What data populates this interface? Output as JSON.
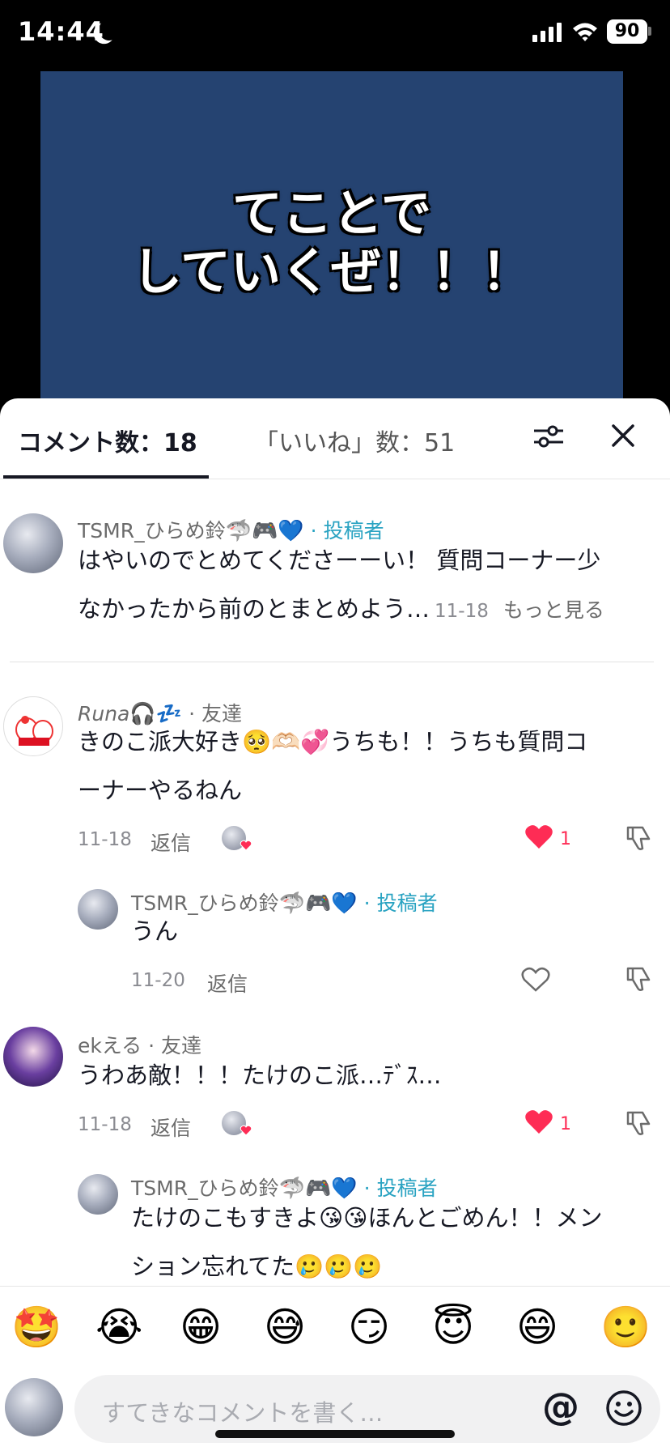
{
  "status_bar": {
    "time": "14:44",
    "battery": "90"
  },
  "video": {
    "caption_line1": "てことで",
    "caption_line2": "していくぜ！！！"
  },
  "tabs": {
    "comments": "コメント数：18",
    "likes": "「いいね」数：51"
  },
  "comments": [
    {
      "username": "TSMR_ひらめ鈴",
      "username_emoji": "🦈🎮💙",
      "tag": "· 投稿者",
      "text_line1": "はやいのでとめてくださーーい！ 質問コーナー少",
      "text_line2": "なかったから前のとまとめよう…",
      "date": "11-18",
      "more": "もっと見る"
    },
    {
      "username": "Runa",
      "username_emoji": "🎧💤",
      "tag": "· 友達",
      "text_line1": "きのこ派大好き🥺🫶🏻💞うちも！！うちも質問コ",
      "text_line2": "ーナーやるねん",
      "date": "11-18",
      "reply": "返信",
      "likes": "1"
    },
    {
      "username": "TSMR_ひらめ鈴",
      "username_emoji": "🦈🎮💙",
      "tag": "· 投稿者",
      "text_line1": "うん",
      "date": "11-20",
      "reply": "返信"
    },
    {
      "username": "ekえる",
      "tag": "· 友達",
      "text_line1": "うわあ敵！！！たけのこ派…ﾃﾞｽ…",
      "date": "11-18",
      "reply": "返信",
      "likes": "1"
    },
    {
      "username": "TSMR_ひらめ鈴",
      "username_emoji": "🦈🎮💙",
      "tag": "· 投稿者",
      "text_line1": "たけのこもすきよ😘😘ほんとごめん！！メン",
      "text_line2": "ション忘れてた🥲🥲🥲"
    }
  ],
  "emoji_bar": [
    "🤩",
    "😭",
    "😁",
    "😅",
    "😏",
    "😇",
    "😄",
    "🙂"
  ],
  "input": {
    "placeholder": "すてきなコメントを書く…",
    "at": "@"
  },
  "colors": {
    "accent": "#fe2c55",
    "author_tag": "#2aa3c2",
    "video_bg": "#254371"
  },
  "icons": [
    "moon-icon",
    "signal-icon",
    "wifi-icon",
    "filter-icon",
    "close-icon",
    "heart-icon",
    "dislike-icon",
    "smile-icon"
  ]
}
